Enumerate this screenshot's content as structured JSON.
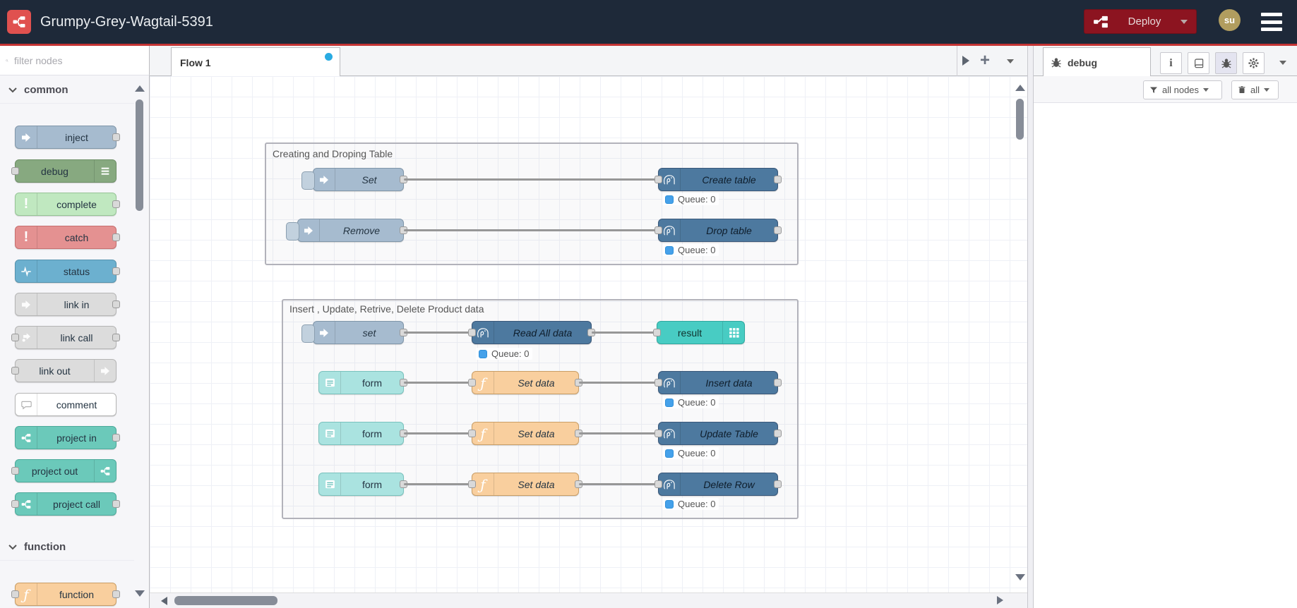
{
  "header": {
    "app_title": "Grumpy-Grey-Wagtail-5391",
    "deploy_label": "Deploy",
    "user_initials": "su"
  },
  "palette": {
    "filter_placeholder": "filter nodes",
    "category_common": "common",
    "category_function": "function",
    "nodes": {
      "inject": "inject",
      "debug": "debug",
      "complete": "complete",
      "catch": "catch",
      "status": "status",
      "link_in": "link in",
      "link_call": "link call",
      "link_out": "link out",
      "comment": "comment",
      "project_in": "project in",
      "project_out": "project out",
      "project_call": "project call",
      "function": "function"
    }
  },
  "workspace": {
    "tab_label": "Flow 1"
  },
  "flow": {
    "queue_label": "Queue: 0",
    "group1": {
      "title": "Creating and Droping Table",
      "inject_set": "Set",
      "pg_create": "Create table",
      "inject_remove": "Remove",
      "pg_drop": "Drop table"
    },
    "group2": {
      "title": "Insert , Update, Retrive, Delete Product data",
      "inject_set": "set",
      "pg_read": "Read All data",
      "debug_result": "result",
      "form": "form",
      "func_setdata": "Set data",
      "pg_insert": "Insert data",
      "pg_update": "Update Table",
      "pg_delete": "Delete Row"
    }
  },
  "sidebar": {
    "tab_label": "debug",
    "filter_button": "all nodes",
    "clear_button": "all"
  },
  "colors": {
    "header_bg": "#1e2939",
    "header_rule": "#c43434",
    "deploy_bg": "#8c1420",
    "brand_red": "#e0514f",
    "postgres_node": "#4d799f",
    "inject_node": "#a6bbcf",
    "function_node": "#f9cf9e",
    "form_node": "#aae3e0",
    "table_node": "#48ccc3",
    "queue_dot": "#45a1ea",
    "tab_dot": "#29abe2"
  }
}
